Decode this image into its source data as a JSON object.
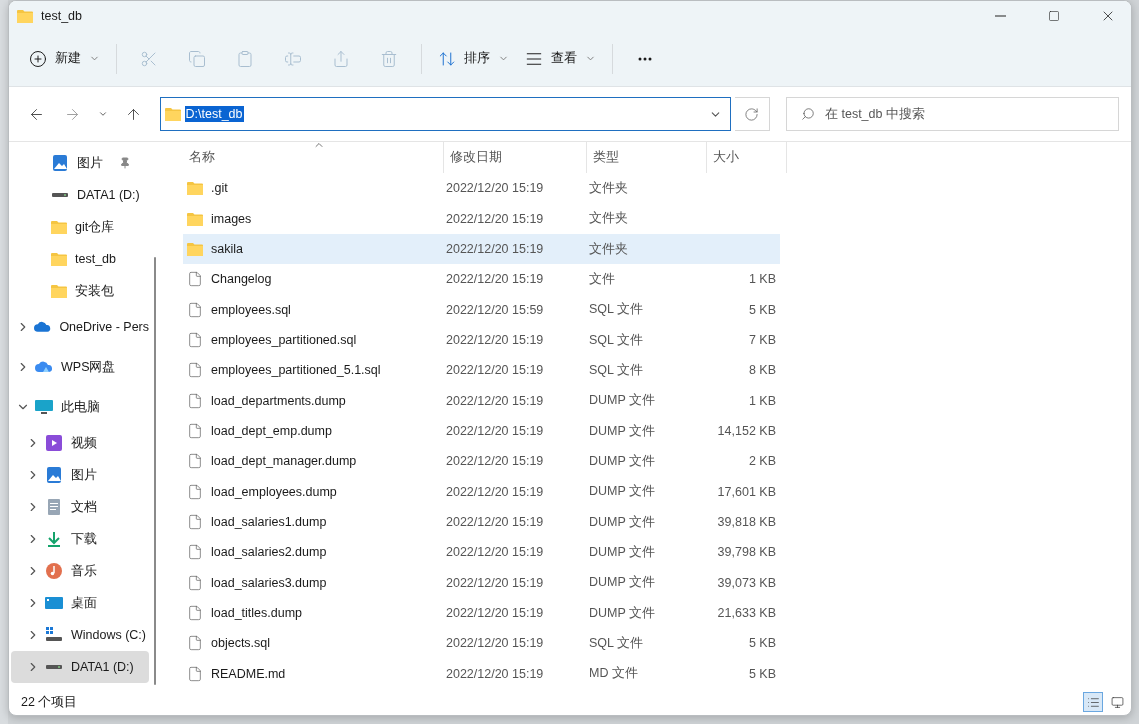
{
  "window": {
    "title": "test_db"
  },
  "toolbar": [
    {
      "kind": "new",
      "label": "新建",
      "disabled": false
    },
    {
      "kind": "cut",
      "disabled": true
    },
    {
      "kind": "copy",
      "disabled": true
    },
    {
      "kind": "paste",
      "disabled": true
    },
    {
      "kind": "rename",
      "disabled": true
    },
    {
      "kind": "share",
      "disabled": true
    },
    {
      "kind": "delete",
      "disabled": true
    },
    {
      "kind": "sort",
      "label": "排序",
      "disabled": false
    },
    {
      "kind": "view",
      "label": "查看",
      "disabled": false
    },
    {
      "kind": "more",
      "disabled": false
    }
  ],
  "address": {
    "value": "D:\\test_db",
    "selected": true
  },
  "search": {
    "placeholder": "在 test_db 中搜索"
  },
  "sidebar": {
    "pinned": [
      {
        "kind": "pictures",
        "label": "图片",
        "pinned": true,
        "selected": false
      },
      {
        "kind": "drive",
        "label": "DATA1 (D:)",
        "pinned": false,
        "selected": false
      },
      {
        "kind": "folder",
        "label": "git仓库",
        "pinned": false,
        "selected": false
      },
      {
        "kind": "folder",
        "label": "test_db",
        "pinned": false,
        "selected": false
      },
      {
        "kind": "folder",
        "label": "安装包",
        "pinned": false,
        "selected": false
      }
    ],
    "tree": [
      {
        "kind": "onedrive",
        "label": "OneDrive - Pers",
        "expanded": false,
        "selected": false
      },
      {
        "kind": "wps",
        "label": "WPS网盘",
        "expanded": false,
        "selected": false
      },
      {
        "kind": "pc",
        "label": "此电脑",
        "expanded": true,
        "selected": false,
        "children": [
          {
            "kind": "video",
            "label": "视频",
            "expanded": false,
            "selected": false
          },
          {
            "kind": "pictures",
            "label": "图片",
            "expanded": false,
            "selected": false
          },
          {
            "kind": "documents",
            "label": "文档",
            "expanded": false,
            "selected": false
          },
          {
            "kind": "downloads",
            "label": "下载",
            "expanded": false,
            "selected": false
          },
          {
            "kind": "music",
            "label": "音乐",
            "expanded": false,
            "selected": false
          },
          {
            "kind": "desktop",
            "label": "桌面",
            "expanded": false,
            "selected": false
          },
          {
            "kind": "windows",
            "label": "Windows (C:)",
            "expanded": false,
            "selected": false
          },
          {
            "kind": "drive",
            "label": "DATA1 (D:)",
            "expanded": false,
            "selected": true
          }
        ]
      }
    ]
  },
  "table": {
    "columns": [
      {
        "label": "名称",
        "sorted": true
      },
      {
        "label": "修改日期",
        "sorted": false
      },
      {
        "label": "类型",
        "sorted": false
      },
      {
        "label": "大小",
        "sorted": false
      }
    ],
    "rows": [
      {
        "kind": "folder",
        "name": ".git",
        "date": "2022/12/20 15:19",
        "type": "文件夹",
        "size": "",
        "selected": false
      },
      {
        "kind": "folder",
        "name": "images",
        "date": "2022/12/20 15:19",
        "type": "文件夹",
        "selected": false
      },
      {
        "kind": "folder",
        "name": "sakila",
        "date": "2022/12/20 15:19",
        "type": "文件夹",
        "selected": true
      },
      {
        "kind": "file",
        "name": "Changelog",
        "date": "2022/12/20 15:19",
        "type": "文件",
        "size": "1 KB",
        "selected": false
      },
      {
        "kind": "file",
        "name": "employees.sql",
        "date": "2022/12/20 15:59",
        "type": "SQL 文件",
        "size": "5 KB",
        "selected": false
      },
      {
        "kind": "file",
        "name": "employees_partitioned.sql",
        "date": "2022/12/20 15:19",
        "type": "SQL 文件",
        "size": "7 KB",
        "selected": false
      },
      {
        "kind": "file",
        "name": "employees_partitioned_5.1.sql",
        "date": "2022/12/20 15:19",
        "type": "SQL 文件",
        "size": "8 KB",
        "selected": false
      },
      {
        "kind": "file",
        "name": "load_departments.dump",
        "date": "2022/12/20 15:19",
        "type": "DUMP 文件",
        "size": "1 KB",
        "selected": false
      },
      {
        "kind": "file",
        "name": "load_dept_emp.dump",
        "date": "2022/12/20 15:19",
        "type": "DUMP 文件",
        "size": "14,152 KB",
        "selected": false
      },
      {
        "kind": "file",
        "name": "load_dept_manager.dump",
        "date": "2022/12/20 15:19",
        "type": "DUMP 文件",
        "size": "2 KB",
        "selected": false
      },
      {
        "kind": "file",
        "name": "load_employees.dump",
        "date": "2022/12/20 15:19",
        "type": "DUMP 文件",
        "size": "17,601 KB",
        "selected": false
      },
      {
        "kind": "file",
        "name": "load_salaries1.dump",
        "date": "2022/12/20 15:19",
        "type": "DUMP 文件",
        "size": "39,818 KB",
        "selected": false
      },
      {
        "kind": "file",
        "name": "load_salaries2.dump",
        "date": "2022/12/20 15:19",
        "type": "DUMP 文件",
        "size": "39,798 KB",
        "selected": false
      },
      {
        "kind": "file",
        "name": "load_salaries3.dump",
        "date": "2022/12/20 15:19",
        "type": "DUMP 文件",
        "size": "39,073 KB",
        "selected": false
      },
      {
        "kind": "file",
        "name": "load_titles.dump",
        "date": "2022/12/20 15:19",
        "type": "DUMP 文件",
        "size": "21,633 KB",
        "selected": false
      },
      {
        "kind": "file",
        "name": "objects.sql",
        "date": "2022/12/20 15:19",
        "type": "SQL 文件",
        "size": "5 KB",
        "selected": false
      },
      {
        "kind": "file",
        "name": "README.md",
        "date": "2022/12/20 15:19",
        "type": "MD 文件",
        "size": "5 KB",
        "selected": false
      }
    ]
  },
  "status_bar": {
    "count": "22 个项目",
    "views": [
      {
        "kind": "details",
        "selected": true
      },
      {
        "kind": "tiles",
        "selected": false
      }
    ]
  }
}
